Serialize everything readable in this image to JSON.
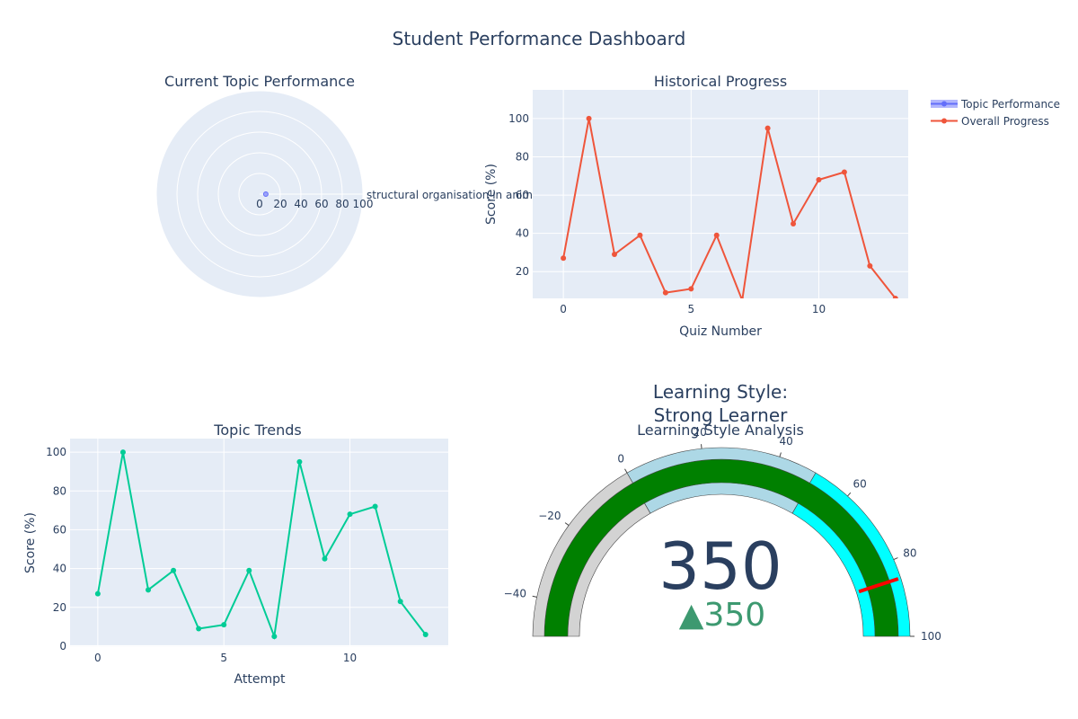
{
  "title": "Student Performance Dashboard",
  "colors": {
    "background": "#ffffff",
    "plot_bg": "#e5ecf6",
    "grid": "#ffffff",
    "text": "#2a3f5f",
    "topic_series": "#636efa",
    "overall_series": "#ef553b",
    "trend_series": "#00cc96",
    "gauge_bar": "#008000",
    "gauge_step_low": "#d3d3d3",
    "gauge_step_mid": "#add8e6",
    "gauge_step_high": "#00ffff",
    "threshold": "#ff0000",
    "delta_up": "#3d9970"
  },
  "chart_data": [
    {
      "id": "radar",
      "type": "polar",
      "title": "Current Topic Performance",
      "categories": [
        "structural organisation in animals"
      ],
      "series": [
        {
          "name": "Topic Performance",
          "values": [
            6
          ]
        }
      ],
      "radial_range": [
        0,
        100
      ],
      "radial_ticks": [
        "0",
        "20",
        "40",
        "60",
        "80",
        "100"
      ]
    },
    {
      "id": "history",
      "type": "line",
      "title": "Historical Progress",
      "xlabel": "Quiz Number",
      "ylabel": "Score (%)",
      "x": [
        0,
        1,
        2,
        3,
        4,
        5,
        6,
        7,
        8,
        9,
        10,
        11,
        12,
        13
      ],
      "series": [
        {
          "name": "Overall Progress",
          "values": [
            27,
            100,
            29,
            39,
            9,
            11,
            39,
            5,
            95,
            45,
            68,
            72,
            23,
            6
          ]
        }
      ],
      "xlim": [
        -1.2,
        13.5
      ],
      "ylim": [
        6,
        115
      ],
      "xticks": [
        "0",
        "5",
        "10"
      ],
      "xtick_values": [
        0,
        5,
        10
      ],
      "yticks": [
        "20",
        "40",
        "60",
        "80",
        "100"
      ],
      "ytick_values": [
        20,
        40,
        60,
        80,
        100
      ],
      "grid": true
    },
    {
      "id": "trends",
      "type": "line",
      "title": "Topic Trends",
      "xlabel": "Attempt",
      "ylabel": "Score (%)",
      "x": [
        0,
        1,
        2,
        3,
        4,
        5,
        6,
        7,
        8,
        9,
        10,
        11,
        12,
        13
      ],
      "series": [
        {
          "name": "Topic Performance",
          "values": [
            27,
            100,
            29,
            39,
            9,
            11,
            39,
            5,
            95,
            45,
            68,
            72,
            23,
            6
          ]
        }
      ],
      "xlim": [
        -1.1,
        13.9
      ],
      "ylim": [
        -0.5,
        107
      ],
      "xticks": [
        "0",
        "5",
        "10"
      ],
      "xtick_values": [
        0,
        5,
        10
      ],
      "yticks": [
        "0",
        "20",
        "40",
        "60",
        "80",
        "100"
      ],
      "ytick_values": [
        0,
        20,
        40,
        60,
        80,
        100
      ],
      "grid": true
    },
    {
      "id": "gauge",
      "type": "gauge",
      "title": "Learning Style Analysis",
      "indicator_title_line1": "Learning Style:",
      "indicator_title_line2": "Strong Learner",
      "value": 350,
      "value_label": "350",
      "delta": 350,
      "delta_label": "▲350",
      "range": [
        -50,
        100
      ],
      "ticks": [
        "−40",
        "−20",
        "0",
        "20",
        "40",
        "60",
        "80",
        "100"
      ],
      "tick_values": [
        -40,
        -20,
        0,
        20,
        40,
        60,
        80,
        100
      ],
      "steps": [
        {
          "from": -50,
          "to": 0
        },
        {
          "from": 0,
          "to": 50
        },
        {
          "from": 50,
          "to": 100
        }
      ],
      "threshold": 85
    }
  ],
  "legend": {
    "placement": "top-right",
    "items": [
      {
        "name": "Topic Performance",
        "symbol": "band"
      },
      {
        "name": "Overall Progress",
        "symbol": "line"
      }
    ]
  }
}
